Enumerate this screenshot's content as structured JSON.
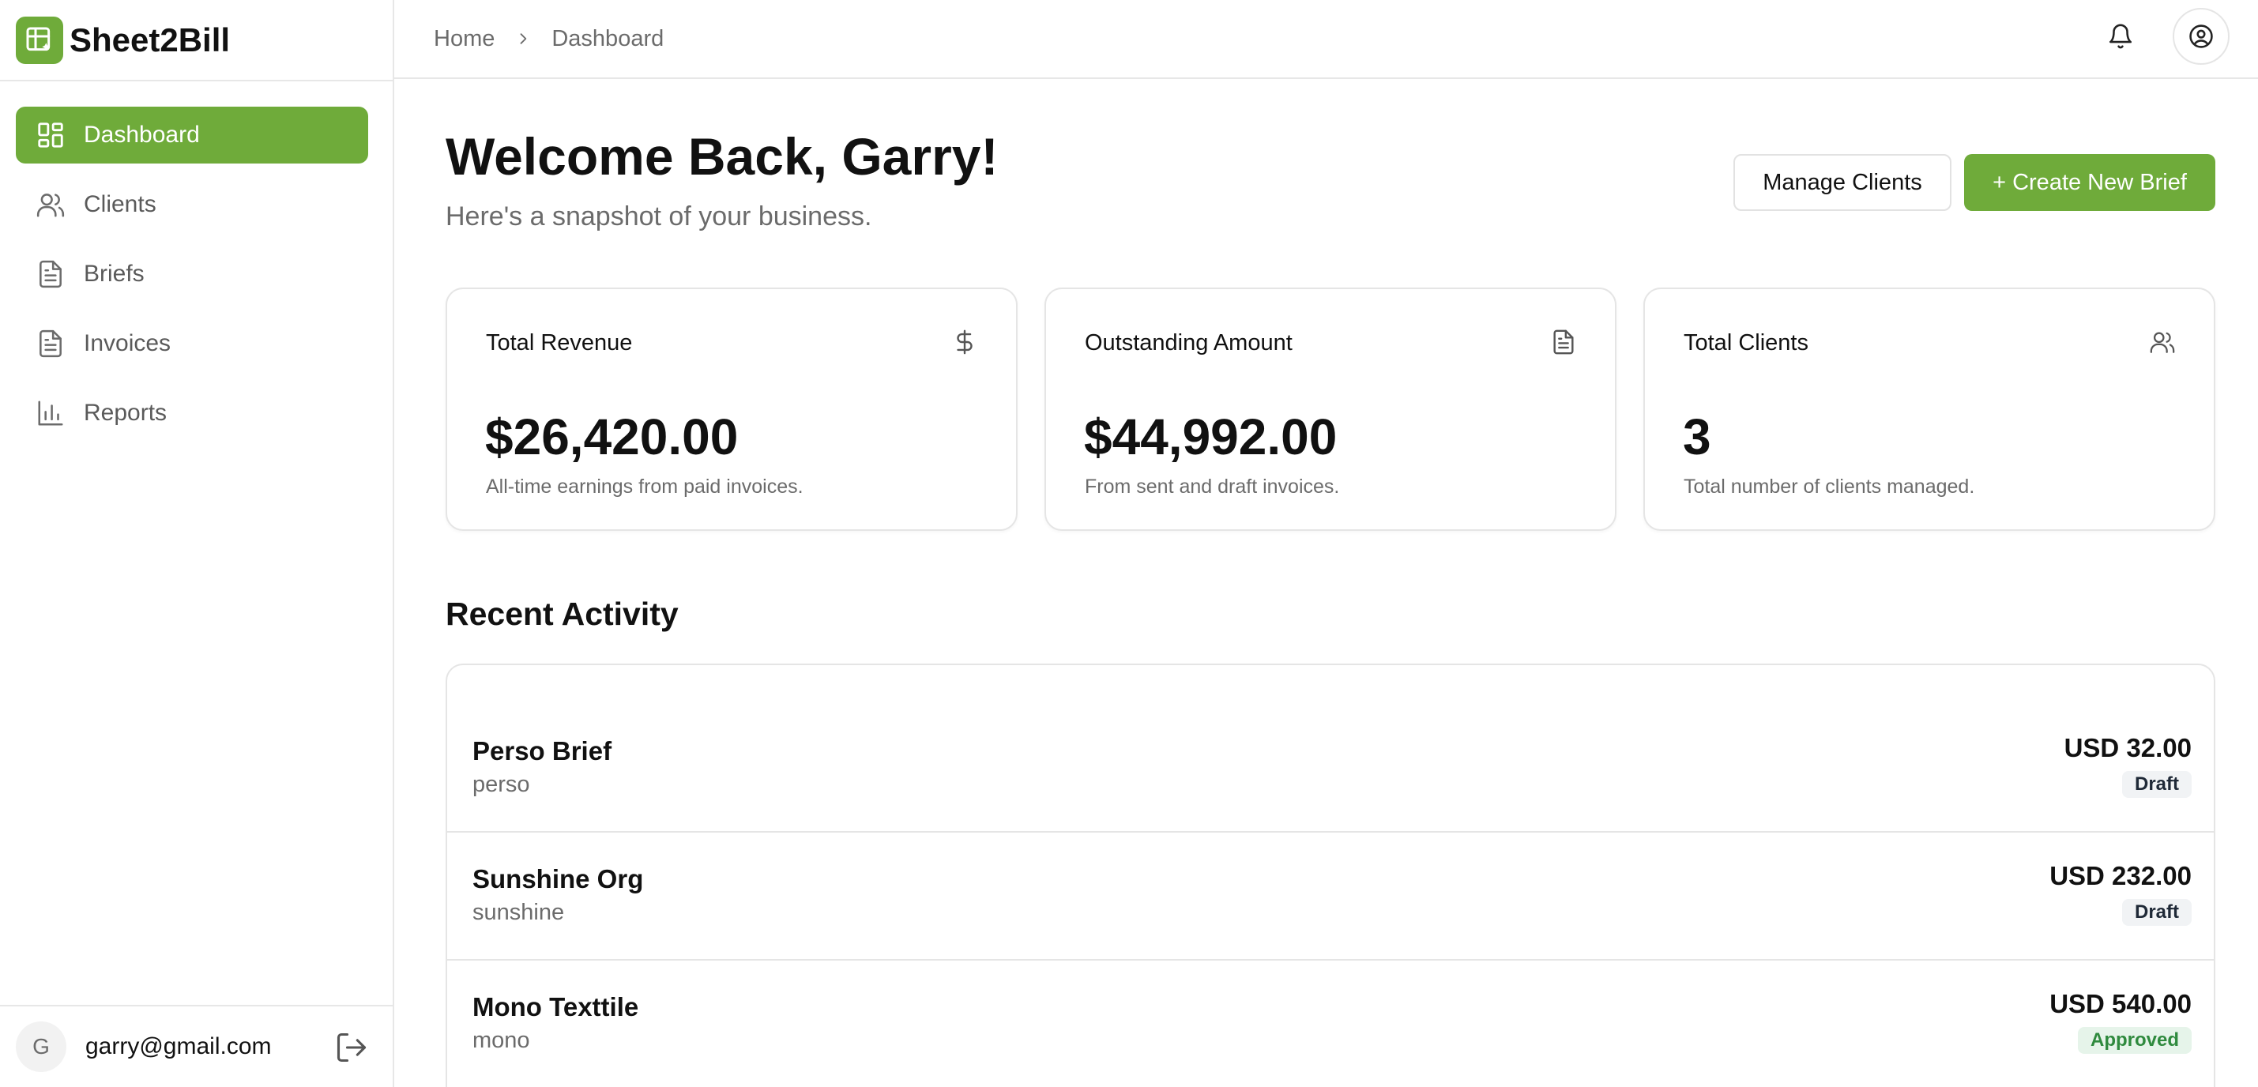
{
  "app": {
    "name": "Sheet2Bill",
    "accent": "#6fab3a"
  },
  "sidebar": {
    "items": [
      {
        "label": "Dashboard",
        "icon": "dashboard-grid-icon",
        "active": true
      },
      {
        "label": "Clients",
        "icon": "users-icon",
        "active": false
      },
      {
        "label": "Briefs",
        "icon": "document-icon",
        "active": false
      },
      {
        "label": "Invoices",
        "icon": "document-icon",
        "active": false
      },
      {
        "label": "Reports",
        "icon": "bar-chart-icon",
        "active": false
      }
    ],
    "user": {
      "initial": "G",
      "email": "garry@gmail.com"
    }
  },
  "topbar": {
    "breadcrumb": [
      "Home",
      "Dashboard"
    ]
  },
  "header": {
    "title": "Welcome Back, Garry!",
    "subtitle": "Here's a snapshot of your business.",
    "manage_clients_label": "Manage Clients",
    "create_brief_label": "+ Create New Brief"
  },
  "cards": [
    {
      "title": "Total Revenue",
      "icon": "dollar-icon",
      "value": "$26,420.00",
      "subtitle": "All-time earnings from paid invoices."
    },
    {
      "title": "Outstanding Amount",
      "icon": "document-icon",
      "value": "$44,992.00",
      "subtitle": "From sent and draft invoices."
    },
    {
      "title": "Total Clients",
      "icon": "users-icon",
      "value": "3",
      "subtitle": "Total number of clients managed."
    }
  ],
  "recent_activity": {
    "title": "Recent Activity",
    "rows": [
      {
        "name": "Perso Brief",
        "sub": "perso",
        "amount": "USD 32.00",
        "status": "Draft"
      },
      {
        "name": "Sunshine Org",
        "sub": "sunshine",
        "amount": "USD 232.00",
        "status": "Draft"
      },
      {
        "name": "Mono Texttile",
        "sub": "mono",
        "amount": "USD 540.00",
        "status": "Approved"
      }
    ]
  }
}
